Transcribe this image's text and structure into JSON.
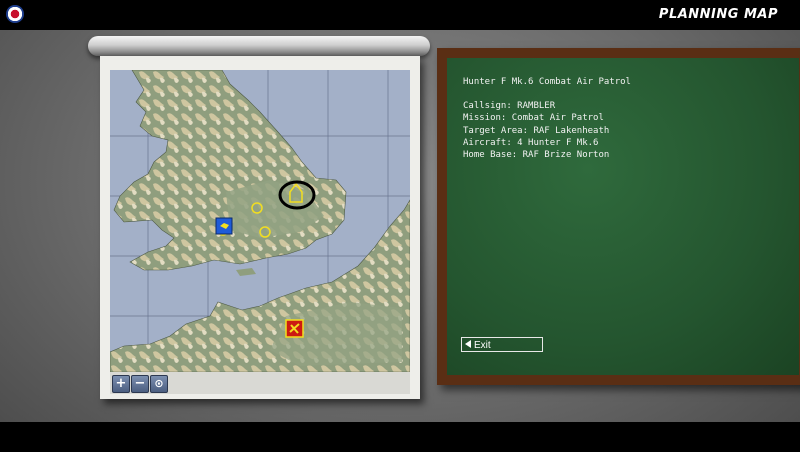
{
  "header": {
    "title": "PLANNING MAP",
    "roundel_icon": "raf-roundel-icon"
  },
  "briefing": {
    "heading": "Hunter F Mk.6 Combat Air Patrol",
    "callsign": "Callsign: RAMBLER",
    "mission": "Mission: Combat Air Patrol",
    "target": "Target Area: RAF Lakenheath",
    "aircraft": "Aircraft: 4 Hunter F Mk.6",
    "home_base": "Home Base: RAF Brize Norton"
  },
  "buttons": {
    "exit_label": "Exit"
  },
  "map_controls": {
    "zoom_in": "+",
    "zoom_out": "−",
    "center": "⊙"
  },
  "colors": {
    "sea": "#a3b0c8",
    "land": "#8f9e7e",
    "highland": "#c8bf99",
    "friendly": "#1e5bd8",
    "enemy": "#cc1a12",
    "waypoint": "#f2de20",
    "chalkboard": "#24552f"
  }
}
